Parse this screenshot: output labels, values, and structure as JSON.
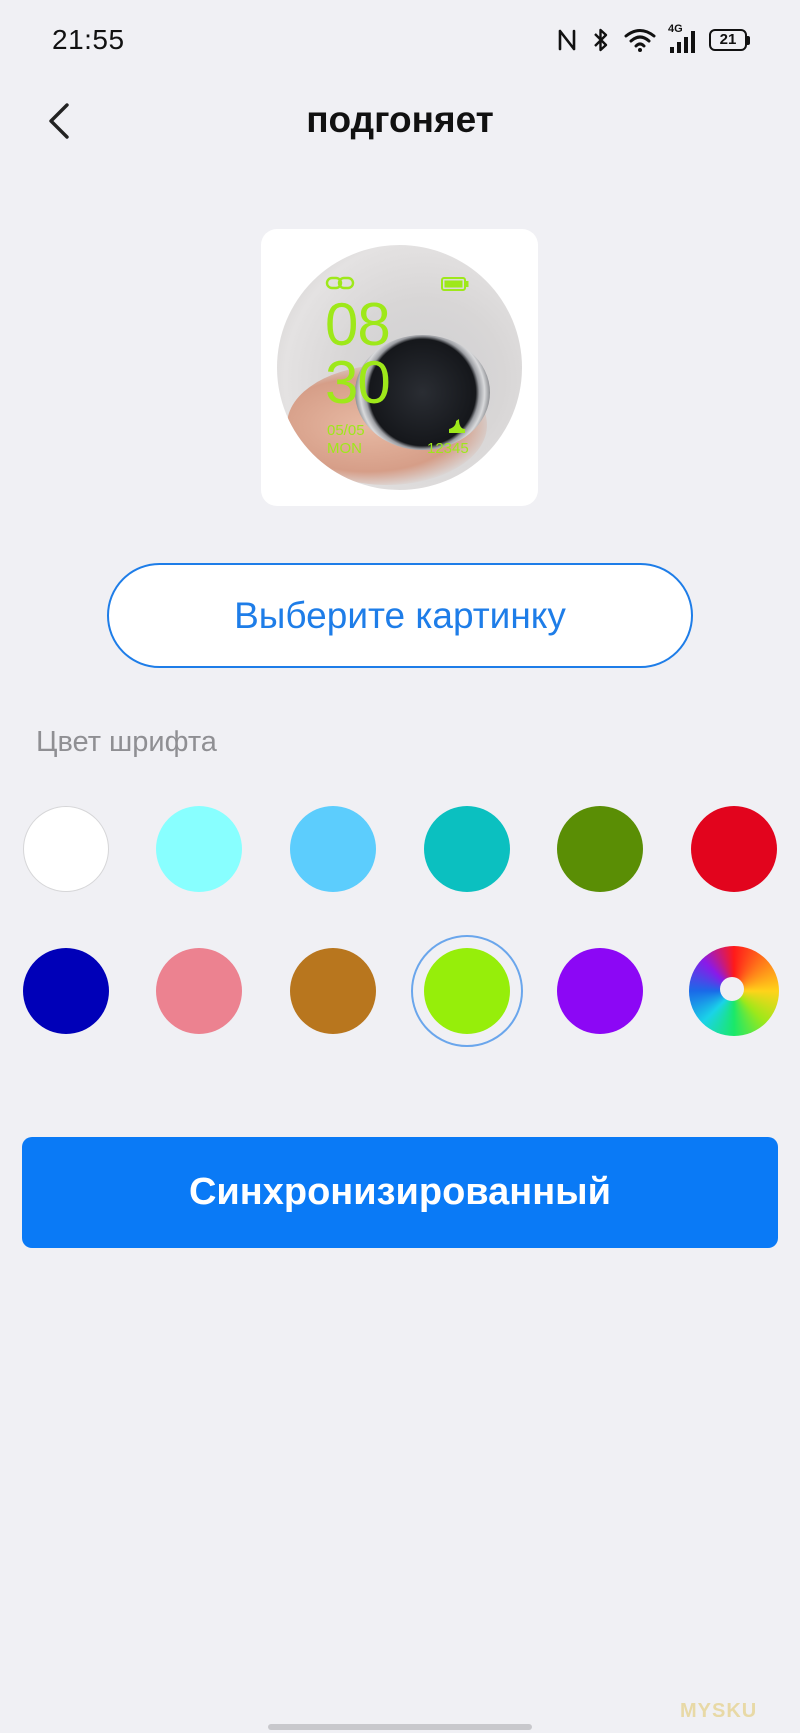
{
  "status_bar": {
    "time": "21:55",
    "battery_level": "21",
    "network": "4G"
  },
  "header": {
    "title": "подгоняет",
    "back_icon": "chevron-left-icon"
  },
  "preview": {
    "hour": "08",
    "minute": "30",
    "date": "05/05",
    "day": "MON",
    "steps": "12345",
    "accent_color": "#9ee81a"
  },
  "choose_picture": {
    "label": "Выберите картинку"
  },
  "font_color": {
    "label": "Цвет шрифта",
    "selected": "#96ee0a",
    "swatches": [
      "#ffffff",
      "#88ffff",
      "#5ccdfd",
      "#0bc0c0",
      "#5a8e05",
      "#e2041d",
      "#0000b8",
      "#ec8290",
      "#b8761e",
      "#96ee0a",
      "#8c07f5",
      "custom-color-wheel"
    ]
  },
  "sync": {
    "label": "Синхронизированный"
  },
  "watermark": "MYSKU"
}
